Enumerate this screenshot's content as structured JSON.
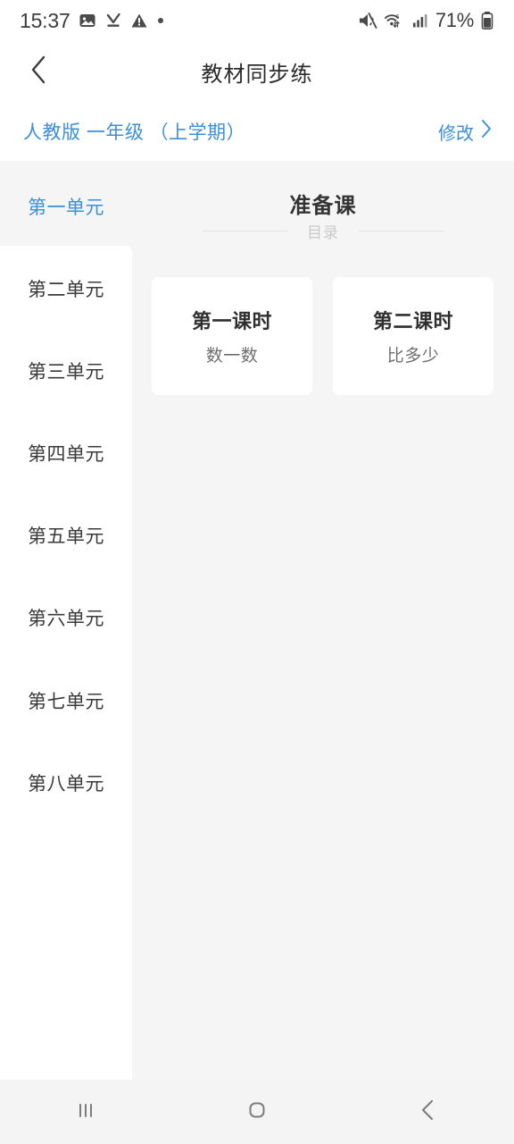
{
  "statusbar": {
    "time": "15:37",
    "battery_percent": "71%",
    "left_icons": [
      "photo-icon",
      "download-icon",
      "warning-icon",
      "dot-icon"
    ],
    "right_icons": [
      "mute-icon",
      "wifi-icon",
      "signal-icon",
      "battery-icon"
    ]
  },
  "header": {
    "title": "教材同步练",
    "back_icon": "chevron-left-icon"
  },
  "version_row": {
    "text": "人教版 一年级 （上学期）",
    "edit_label": "修改",
    "edit_icon": "chevron-right-icon",
    "accent_color": "#3d8fd6"
  },
  "sidebar": {
    "items": [
      {
        "label": "第一单元",
        "active": true
      },
      {
        "label": "第二单元",
        "active": false
      },
      {
        "label": "第三单元",
        "active": false
      },
      {
        "label": "第四单元",
        "active": false
      },
      {
        "label": "第五单元",
        "active": false
      },
      {
        "label": "第六单元",
        "active": false
      },
      {
        "label": "第七单元",
        "active": false
      },
      {
        "label": "第八单元",
        "active": false
      }
    ]
  },
  "content": {
    "title": "准备课",
    "divider_label": "目录",
    "cards": [
      {
        "title": "第一课时",
        "subtitle": "数一数"
      },
      {
        "title": "第二课时",
        "subtitle": "比多少"
      }
    ]
  },
  "navbar": {
    "recents_icon": "recents-icon",
    "home_icon": "home-icon",
    "back_icon": "back-icon"
  }
}
